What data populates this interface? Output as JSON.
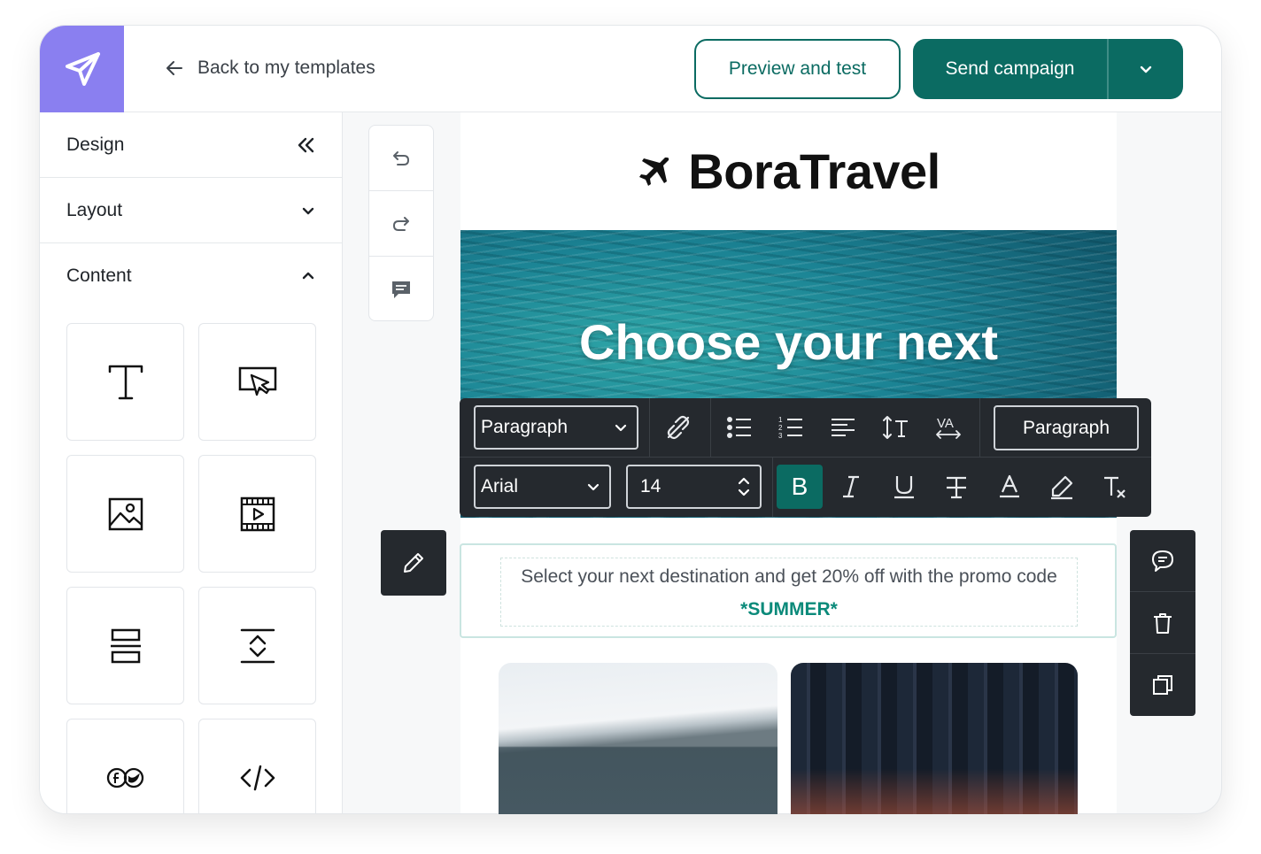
{
  "header": {
    "back_label": "Back to my templates",
    "preview_label": "Preview and test",
    "send_label": "Send campaign"
  },
  "sidebar": {
    "design_label": "Design",
    "layout_label": "Layout",
    "content_label": "Content",
    "blocks": [
      {
        "icon": "text-block-icon"
      },
      {
        "icon": "button-block-icon"
      },
      {
        "icon": "image-block-icon"
      },
      {
        "icon": "video-block-icon"
      },
      {
        "icon": "divider-block-icon"
      },
      {
        "icon": "spacer-block-icon"
      },
      {
        "icon": "social-block-icon"
      },
      {
        "icon": "html-block-icon"
      }
    ]
  },
  "email": {
    "brand_name": "BoraTravel",
    "hero_title": "Choose your next",
    "body_text": "Select your next destination and get 20% off with the promo code ",
    "promo_code": "*SUMMER*"
  },
  "toolbar": {
    "block_type": "Paragraph",
    "font": "Arial",
    "font_size": "14",
    "style_button": "Paragraph",
    "bold_label": "B"
  },
  "colors": {
    "brand_accent": "#8a7ff0",
    "primary": "#0b6b62",
    "toolbar_bg": "#25292e",
    "promo": "#0b8a7a"
  }
}
